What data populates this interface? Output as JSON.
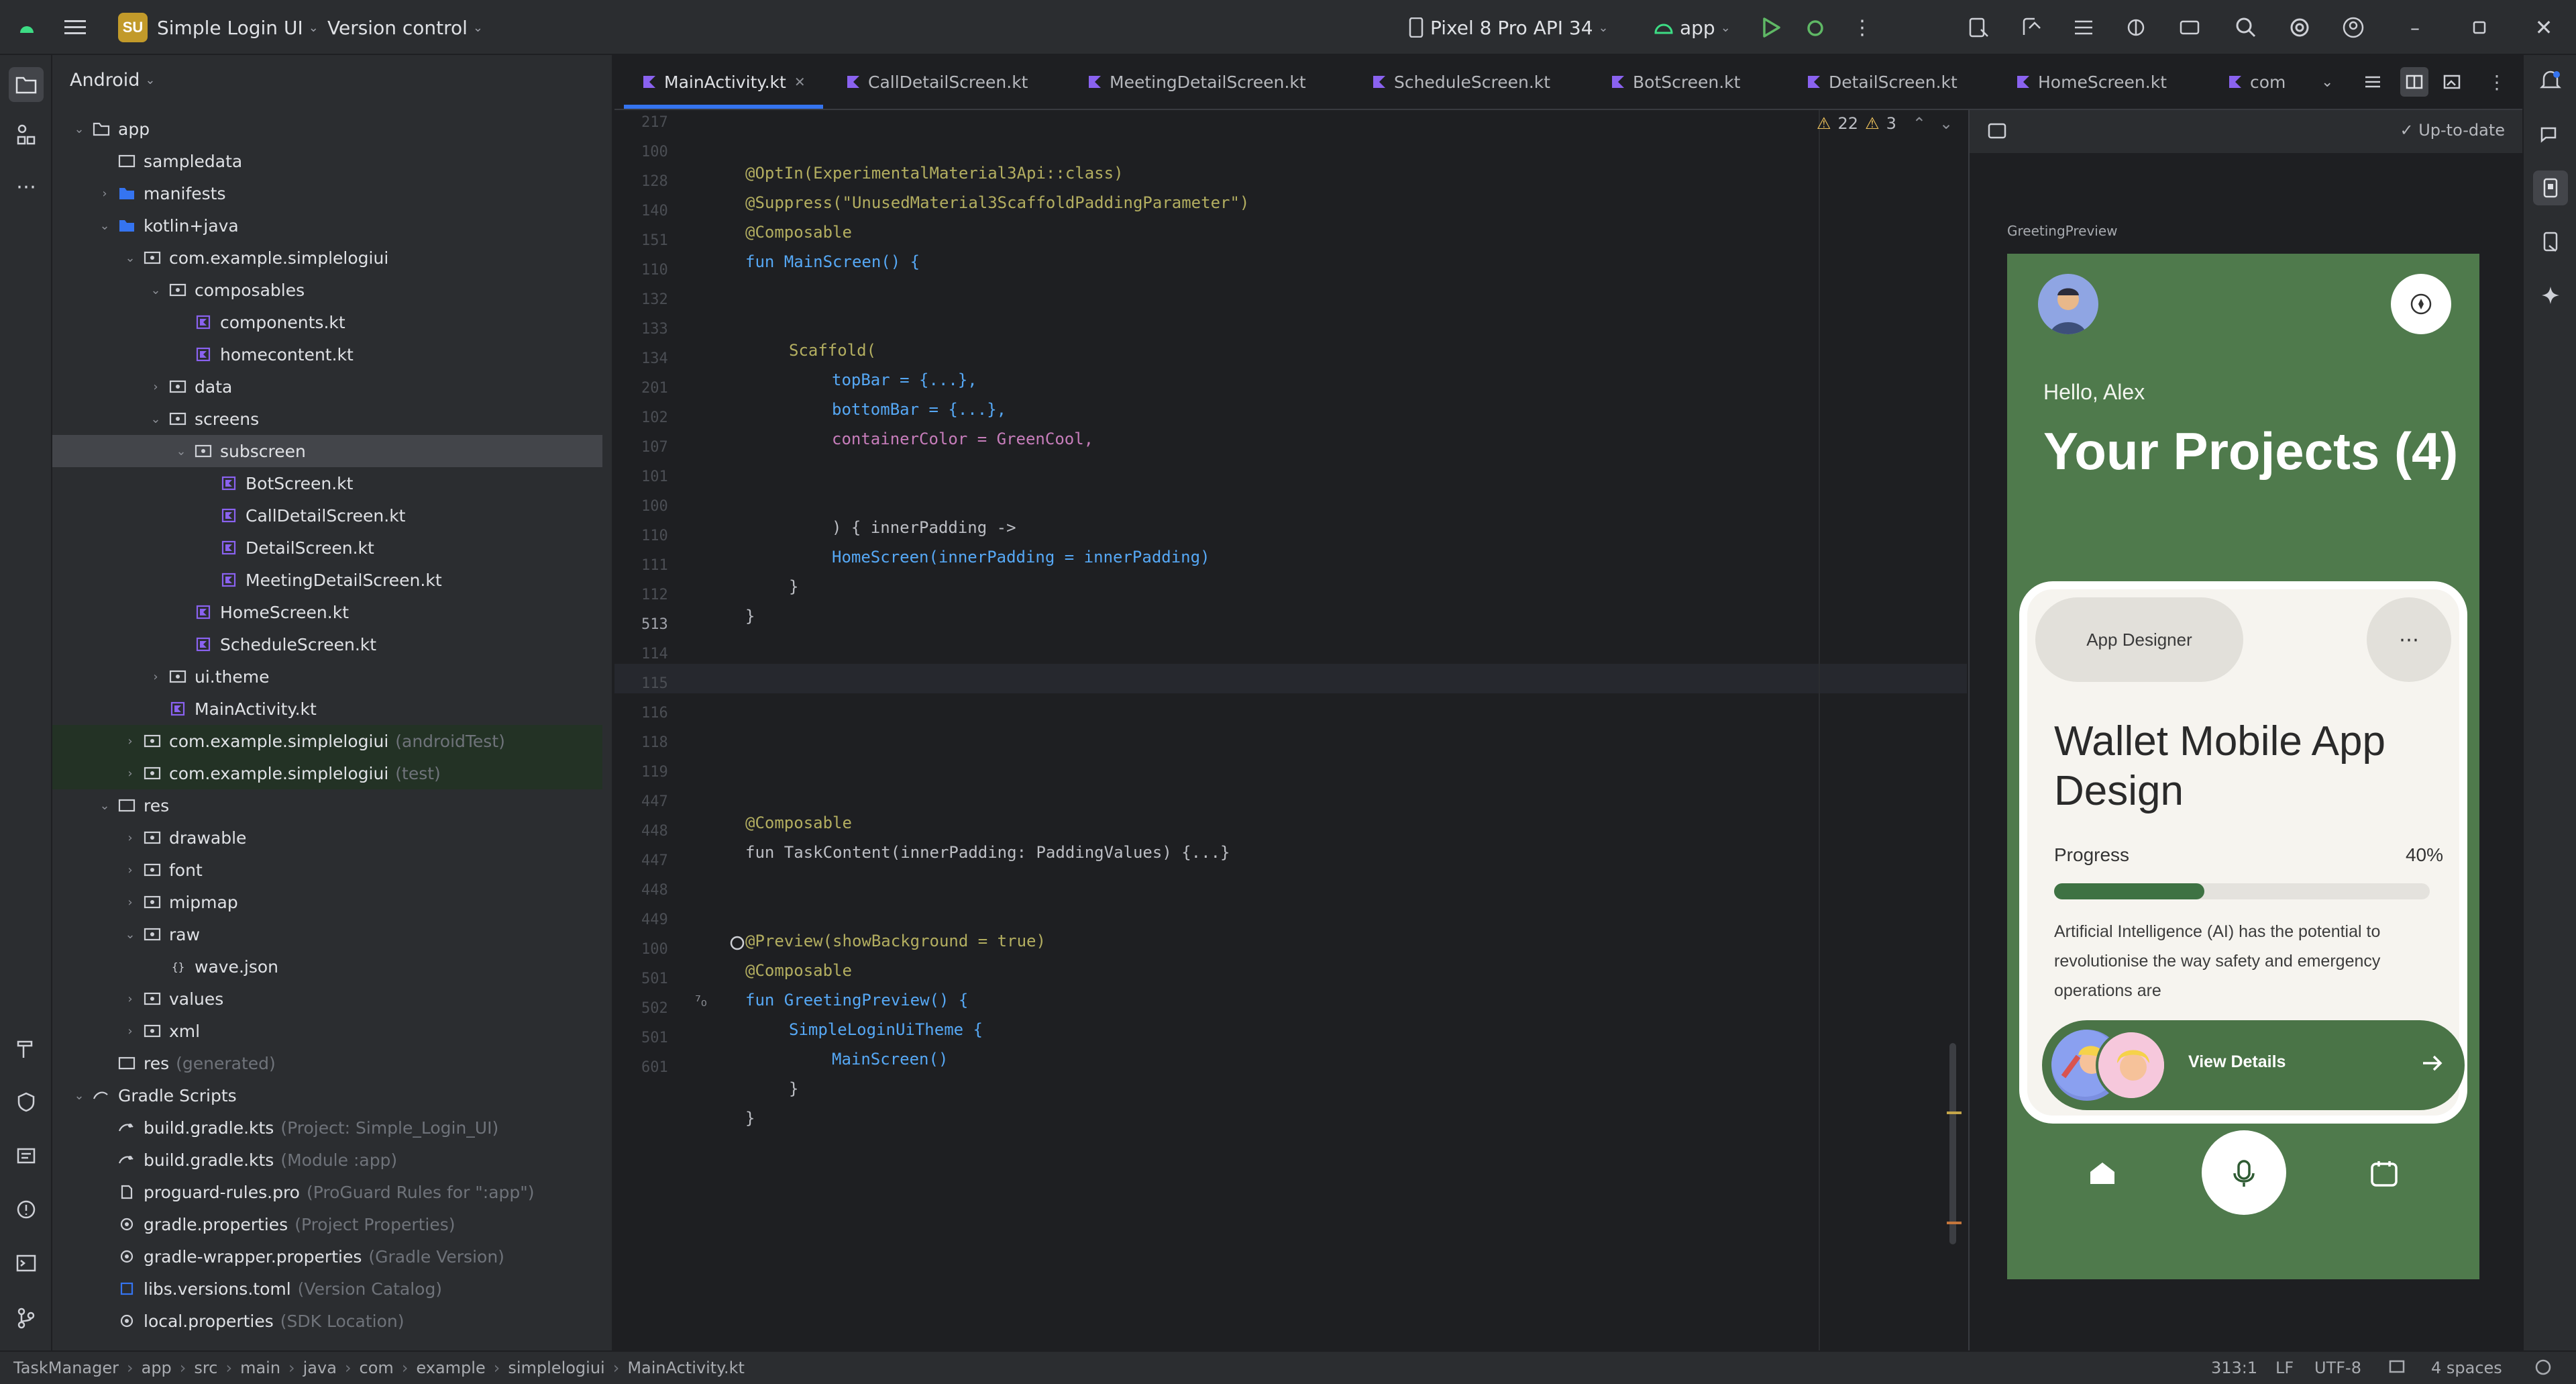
{
  "titlebar": {
    "project_badge": "SU",
    "project_name": "Simple Login UI",
    "vcs": "Version control",
    "device": "Pixel 8 Pro API 34",
    "run_config": "app"
  },
  "project_panel": {
    "header": "Android",
    "tree": [
      {
        "label": "app",
        "sub": "",
        "kind": "module"
      },
      {
        "label": "sampledata",
        "sub": "",
        "kind": "folder"
      },
      {
        "label": "manifests",
        "sub": "",
        "kind": "folder-blue"
      },
      {
        "label": "kotlin+java",
        "sub": "",
        "kind": "folder-blue"
      },
      {
        "label": "com.example.simplelogiui",
        "sub": "",
        "kind": "package"
      },
      {
        "label": "composables",
        "sub": "",
        "kind": "package"
      },
      {
        "label": "components.kt",
        "sub": "",
        "kind": "kt"
      },
      {
        "label": "homecontent.kt",
        "sub": "",
        "kind": "kt"
      },
      {
        "label": "data",
        "sub": "",
        "kind": "package"
      },
      {
        "label": "screens",
        "sub": "",
        "kind": "package"
      },
      {
        "label": "subscreen",
        "sub": "",
        "kind": "package"
      },
      {
        "label": "BotScreen.kt",
        "sub": "",
        "kind": "kt"
      },
      {
        "label": "CallDetailScreen.kt",
        "sub": "",
        "kind": "kt"
      },
      {
        "label": "DetailScreen.kt",
        "sub": "",
        "kind": "kt"
      },
      {
        "label": "MeetingDetailScreen.kt",
        "sub": "",
        "kind": "kt"
      },
      {
        "label": "HomeScreen.kt",
        "sub": "",
        "kind": "kt"
      },
      {
        "label": "ScheduleScreen.kt",
        "sub": "",
        "kind": "kt"
      },
      {
        "label": "ui.theme",
        "sub": "",
        "kind": "package"
      },
      {
        "label": "MainActivity.kt",
        "sub": "",
        "kind": "kt"
      },
      {
        "label": "com.example.simplelogiui",
        "sub": "(androidTest)",
        "kind": "package"
      },
      {
        "label": "com.example.simplelogiui",
        "sub": "(test)",
        "kind": "package"
      },
      {
        "label": "res",
        "sub": "",
        "kind": "folder"
      },
      {
        "label": "drawable",
        "sub": "",
        "kind": "package"
      },
      {
        "label": "font",
        "sub": "",
        "kind": "package"
      },
      {
        "label": "mipmap",
        "sub": "",
        "kind": "package"
      },
      {
        "label": "raw",
        "sub": "",
        "kind": "package"
      },
      {
        "label": "wave.json",
        "sub": "",
        "kind": "json"
      },
      {
        "label": "values",
        "sub": "",
        "kind": "package"
      },
      {
        "label": "xml",
        "sub": "",
        "kind": "package"
      },
      {
        "label": "res",
        "sub": "(generated)",
        "kind": "folder"
      },
      {
        "label": "Gradle Scripts",
        "sub": "",
        "kind": "gradle"
      },
      {
        "label": "build.gradle.kts",
        "sub": "(Project: Simple_Login_UI)",
        "kind": "gradlefile"
      },
      {
        "label": "build.gradle.kts",
        "sub": "(Module :app)",
        "kind": "gradlefile"
      },
      {
        "label": "proguard-rules.pro",
        "sub": "(ProGuard Rules for \":app\")",
        "kind": "file"
      },
      {
        "label": "gradle.properties",
        "sub": "(Project Properties)",
        "kind": "settings"
      },
      {
        "label": "gradle-wrapper.properties",
        "sub": "(Gradle Version)",
        "kind": "settings"
      },
      {
        "label": "libs.versions.toml",
        "sub": "(Version Catalog)",
        "kind": "toml"
      },
      {
        "label": "local.properties",
        "sub": "(SDK Location)",
        "kind": "settings"
      }
    ]
  },
  "tabs": [
    "MainActivity.kt",
    "CallDetailScreen.kt",
    "MeetingDetailScreen.kt",
    "ScheduleScreen.kt",
    "BotScreen.kt",
    "DetailScreen.kt",
    "HomeScreen.kt",
    "com"
  ],
  "editor": {
    "warnings": "22",
    "weak_warnings": "3",
    "line_numbers": [
      "217",
      "100",
      "128",
      "140",
      "151",
      "110",
      "132",
      "133",
      "134",
      "201",
      "102",
      "107",
      "101",
      "100",
      "110",
      "111",
      "112",
      "513",
      "114",
      "115",
      "116",
      "118",
      "119",
      "447",
      "448",
      "447",
      "448",
      "449",
      "100",
      "501",
      "502",
      "501",
      "601"
    ],
    "lines": [
      "@OptIn(ExperimentalMaterial3Api::class)",
      "@Suppress(\"UnusedMaterial3ScaffoldPaddingParameter\")",
      "@Composable",
      "fun MainScreen() {",
      "Scaffold(",
      "topBar = {...},",
      "bottomBar = {...},",
      "containerColor = GreenCool,",
      ") { innerPadding ->",
      "HomeScreen(innerPadding = innerPadding)",
      "}",
      "}",
      "@Composable",
      "fun TaskContent(innerPadding: PaddingValues) {...}",
      "@Preview(showBackground = true)",
      "@Composable",
      "fun GreetingPreview() {",
      "SimpleLoginUiTheme {",
      "MainScreen()",
      "}",
      "}"
    ]
  },
  "preview": {
    "status": "Up-to-date",
    "label": "GreetingPreview",
    "greeting": "Hello, Alex",
    "title": "Your Projects (4)",
    "chip": "App Designer",
    "project_name": "Wallet Mobile App Design",
    "progress_label": "Progress",
    "progress_value": "40%",
    "progress_fraction": 0.4,
    "description": "Artificial Intelligence (AI) has the potential to revolutionise the way safety and emergency operations are",
    "button": "View Details",
    "colors": {
      "screen": "#4f7a4c",
      "card": "#f6f4ef",
      "progress": "#3e7243"
    }
  },
  "statusbar": {
    "crumbs": [
      "TaskManager",
      "app",
      "src",
      "main",
      "java",
      "com",
      "example",
      "simplelogiui",
      "MainActivity.kt"
    ],
    "position": "313:1",
    "line_sep": "LF",
    "encoding": "UTF-8",
    "indent": "4 spaces"
  }
}
